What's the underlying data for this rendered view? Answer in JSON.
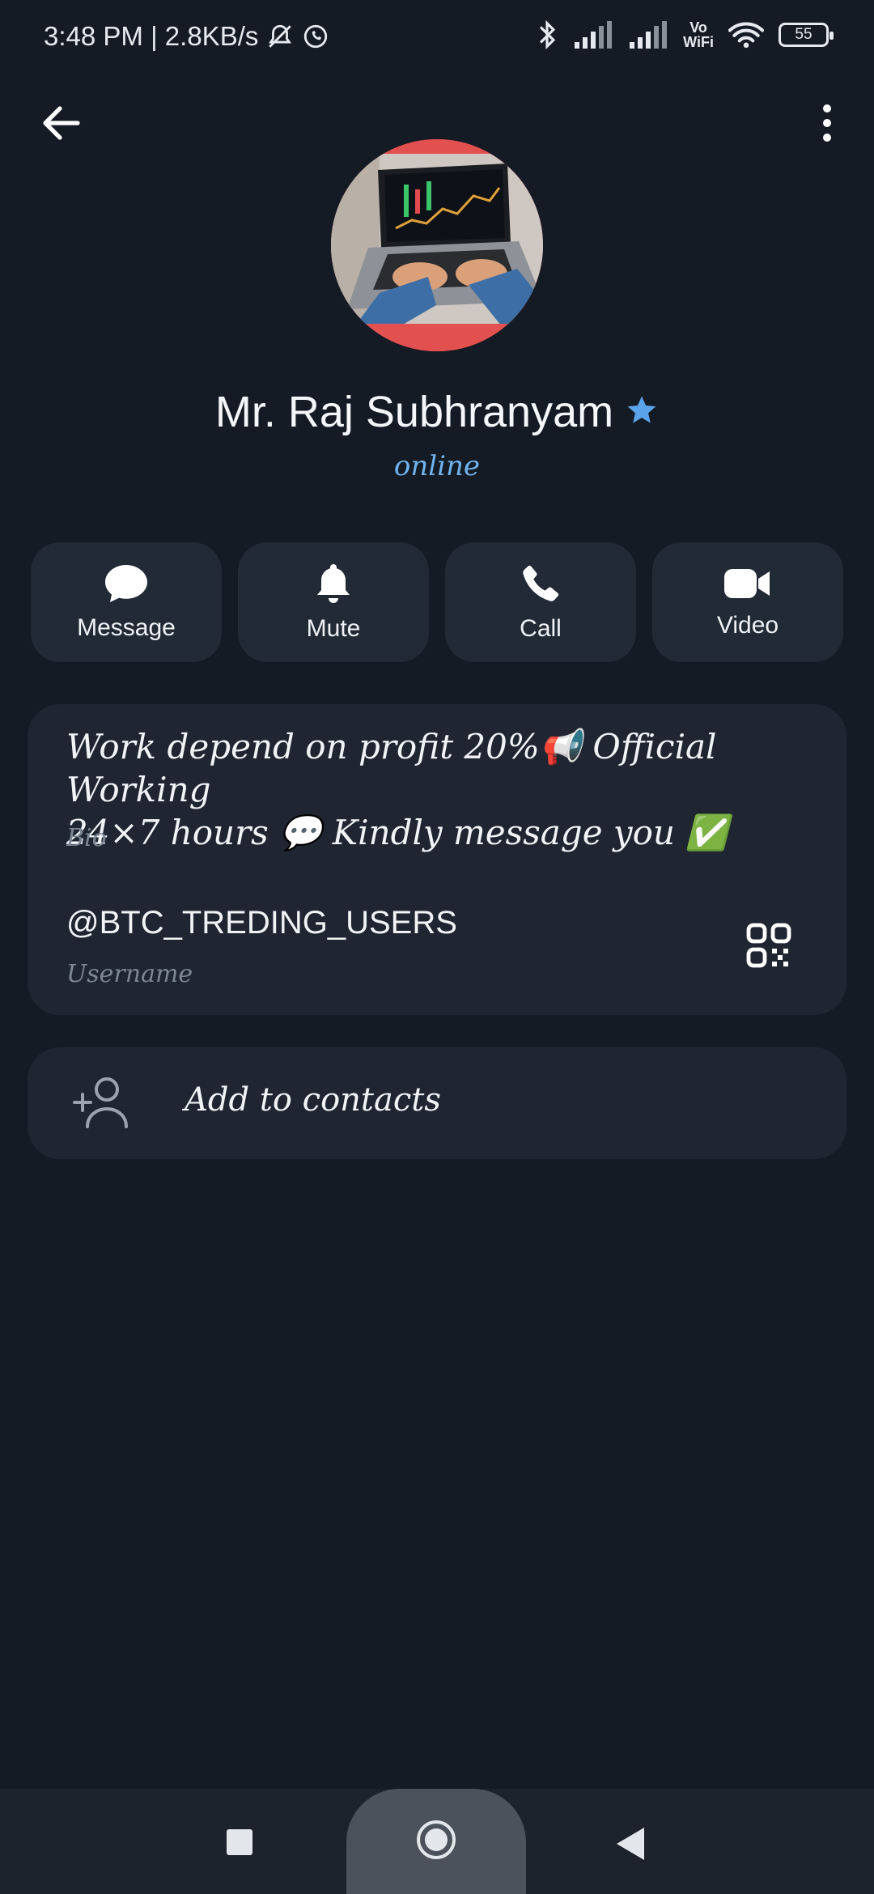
{
  "status_bar": {
    "time_speed": "3:48 PM | 2.8KB/s",
    "vowifi_top": "Vo",
    "vowifi_bottom": "WiFi",
    "battery": "55"
  },
  "profile": {
    "name": "Mr. Raj Subhranyam",
    "status": "online",
    "avatar_icon": "laptop-trading-photo",
    "verified_icon": "star-icon"
  },
  "actions": [
    {
      "label": "Message",
      "icon": "message-icon"
    },
    {
      "label": "Mute",
      "icon": "bell-icon"
    },
    {
      "label": "Call",
      "icon": "phone-icon"
    },
    {
      "label": "Video",
      "icon": "video-icon"
    }
  ],
  "info": {
    "bio_line1": "Work depend on profit 20%📢 Official Working",
    "bio_line2": "24×7 hours 💬 Kindly message you ✅",
    "bio_caption": "Bio",
    "username": "@BTC_TREDING_USERS",
    "username_caption": "Username"
  },
  "add_contact": {
    "label": "Add to contacts"
  },
  "colors": {
    "background": "#151b25",
    "card": "#1f2632",
    "accent": "#6fb4ef",
    "avatar_ring": "#e2504f"
  }
}
